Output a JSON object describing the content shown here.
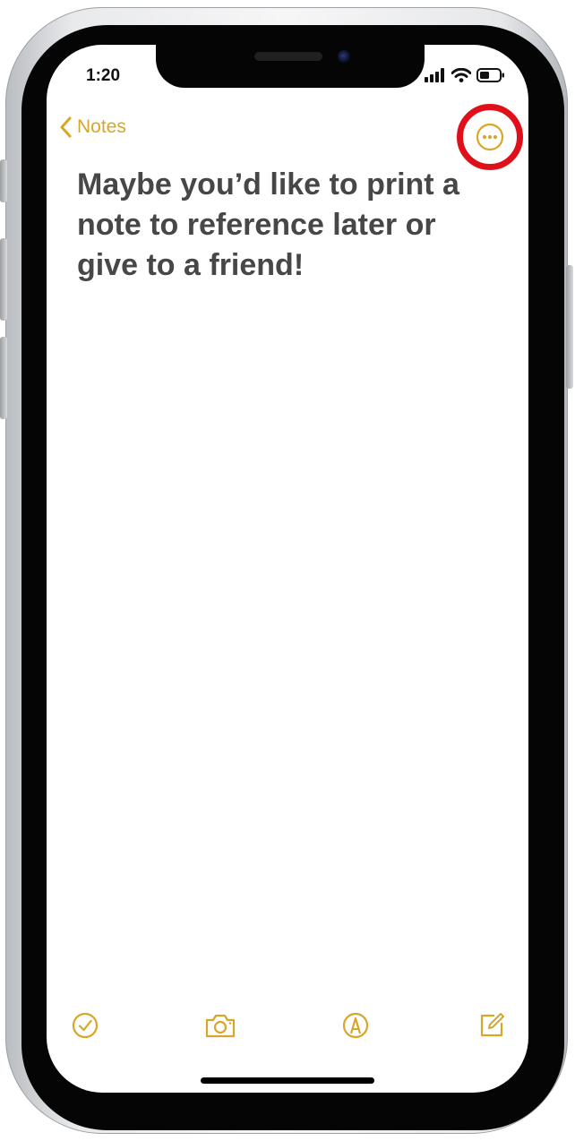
{
  "status_bar": {
    "time": "1:20"
  },
  "nav": {
    "back_label": "Notes"
  },
  "note": {
    "text": "Maybe you’d like to print a note to reference later or give to a friend!"
  },
  "icons": {
    "back": "chevron-left-icon",
    "more": "ellipsis-circle-icon",
    "checklist": "checkmark-circle-icon",
    "camera": "camera-icon",
    "markup": "pen-tip-circle-icon",
    "compose": "compose-icon",
    "signal": "cellular-signal-icon",
    "wifi": "wifi-icon",
    "battery": "battery-icon"
  },
  "colors": {
    "accent": "#d8a628",
    "highlight_ring": "#e0101a",
    "note_text": "#474747"
  }
}
